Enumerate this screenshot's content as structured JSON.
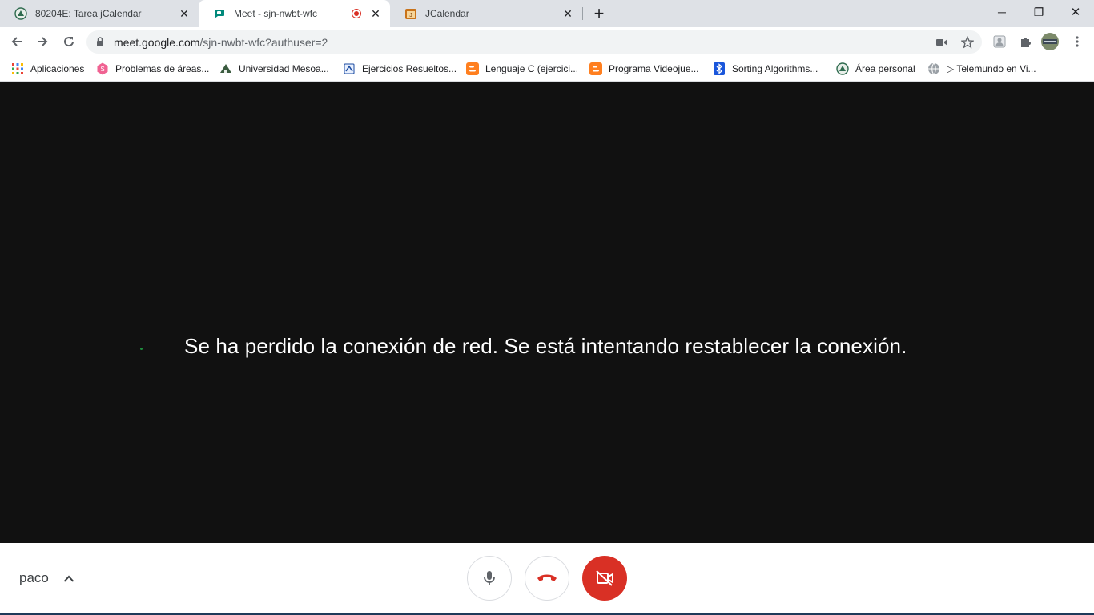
{
  "browser": {
    "tabs": [
      {
        "title": "80204E: Tarea jCalendar",
        "favicon": "university-seal-icon",
        "active": false
      },
      {
        "title": "Meet - sjn-nwbt-wfc",
        "favicon": "google-meet-icon",
        "active": true,
        "recording": true
      },
      {
        "title": "JCalendar",
        "favicon": "jcalendar-icon",
        "active": false
      }
    ],
    "window_controls": {
      "minimize": "─",
      "restore": "❐",
      "close": "✕"
    },
    "new_tab_label": "+",
    "address": {
      "domain": "meet.google.com",
      "path": "/sjn-nwbt-wfc?authuser=2"
    },
    "bookmarks": [
      {
        "label": "Aplicaciones",
        "icon": "apps-grid-icon"
      },
      {
        "label": "Problemas de áreas...",
        "icon": "hexagon-s-icon"
      },
      {
        "label": "Universidad Mesoa...",
        "icon": "university-icon"
      },
      {
        "label": "Ejercicios Resueltos...",
        "icon": "book-icon"
      },
      {
        "label": "Lenguaje C (ejercici...",
        "icon": "blogger-icon"
      },
      {
        "label": "Programa Videojue...",
        "icon": "blogger-icon"
      },
      {
        "label": "Sorting Algorithms...",
        "icon": "bluetooth-icon"
      },
      {
        "label": "Área personal",
        "icon": "university-icon"
      },
      {
        "label": "▷ Telemundo en Vi...",
        "icon": "globe-icon"
      }
    ]
  },
  "meet": {
    "status_message": "Se ha perdido la conexión de red. Se está intentando restablecer la conexión.",
    "user_name": "paco",
    "controls": {
      "mic": "microphone-icon",
      "hangup": "hang-up-icon",
      "camera": "camera-off-icon"
    },
    "colors": {
      "danger": "#d93025",
      "stage": "#111111"
    }
  }
}
